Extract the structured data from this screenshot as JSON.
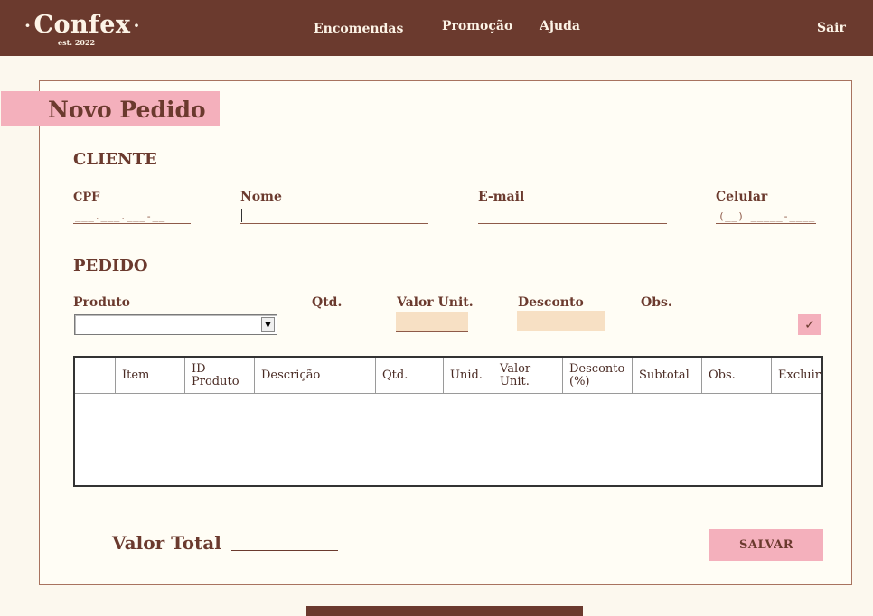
{
  "app": {
    "logo": "Confex",
    "logo_sub": "est. 2022"
  },
  "nav": {
    "encomendas": "Encomendas",
    "promocao": "Promoção",
    "ajuda": "Ajuda",
    "sair": "Sair"
  },
  "page": {
    "title": "Novo Pedido"
  },
  "cliente": {
    "section": "CLIENTE",
    "cpf_label": "CPF",
    "cpf_mask": "___.___.___-__",
    "nome_label": "Nome",
    "nome_value": "",
    "email_label": "E-mail",
    "email_value": "",
    "celular_label": "Celular",
    "celular_mask": "(__) _____-____"
  },
  "pedido": {
    "section": "PEDIDO",
    "produto_label": "Produto",
    "produto_value": "",
    "qtd_label": "Qtd.",
    "valor_unit_label": "Valor Unit.",
    "desconto_label": "Desconto",
    "obs_label": "Obs."
  },
  "grid": {
    "columns": [
      "",
      "Item",
      "ID Produto",
      "Descrição",
      "Qtd.",
      "Unid.",
      "Valor Unit.",
      "Desconto (%)",
      "Subtotal",
      "Obs.",
      "Excluir"
    ],
    "rows": []
  },
  "footer": {
    "total_label": "Valor Total",
    "total_value": "",
    "save_label": "SALVAR"
  },
  "colors": {
    "brand_brown": "#6b3a2e",
    "accent_pink": "#f4b0bc",
    "field_tan": "#f7e0c4",
    "background": "#fcf8ee"
  },
  "icons": {
    "dropdown": "chevron-down-icon",
    "confirm": "check-icon"
  }
}
